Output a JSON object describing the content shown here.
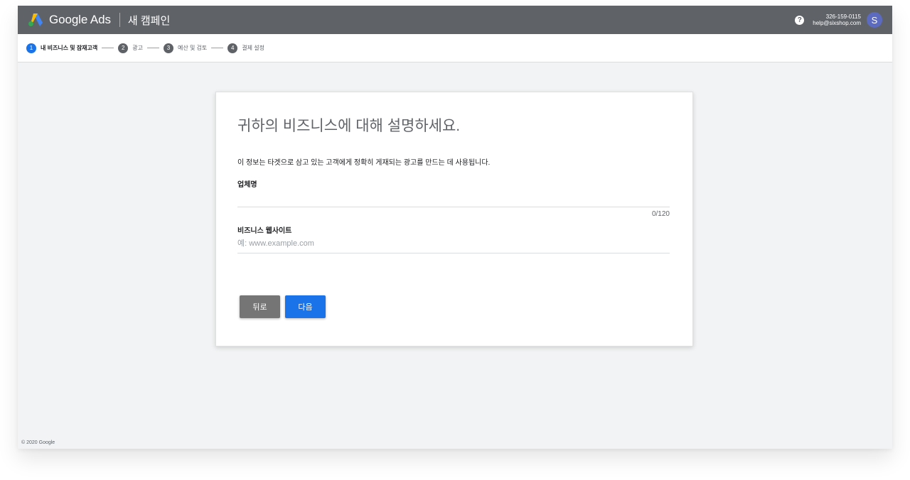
{
  "header": {
    "brand": "Google Ads",
    "campaign_title": "새 캠페인",
    "help_icon": "help-icon",
    "account_id": "326-159-0115",
    "account_email": "help@sixshop.com",
    "avatar_letter": "S"
  },
  "stepper": {
    "steps": [
      {
        "num": "1",
        "label": "내 비즈니스 및 잠재고객",
        "active": true
      },
      {
        "num": "2",
        "label": "광고",
        "active": false
      },
      {
        "num": "3",
        "label": "예산 및 검토",
        "active": false
      },
      {
        "num": "4",
        "label": "결제 설정",
        "active": false
      }
    ]
  },
  "card": {
    "title": "귀하의 비즈니스에 대해 설명하세요.",
    "description": "이 정보는 타겟으로 삼고 있는 고객에게 정확히 게재되는 광고를 만드는 데 사용됩니다.",
    "business_name_label": "업체명",
    "business_name_value": "",
    "business_name_counter": "0/120",
    "website_label": "비즈니스 웹사이트",
    "website_placeholder": "예: www.example.com",
    "back_label": "뒤로",
    "next_label": "다음"
  },
  "footer": {
    "copyright": "© 2020 Google"
  },
  "colors": {
    "topbar": "#5f6368",
    "accent": "#1a73e8",
    "avatar": "#5c6bc0"
  }
}
